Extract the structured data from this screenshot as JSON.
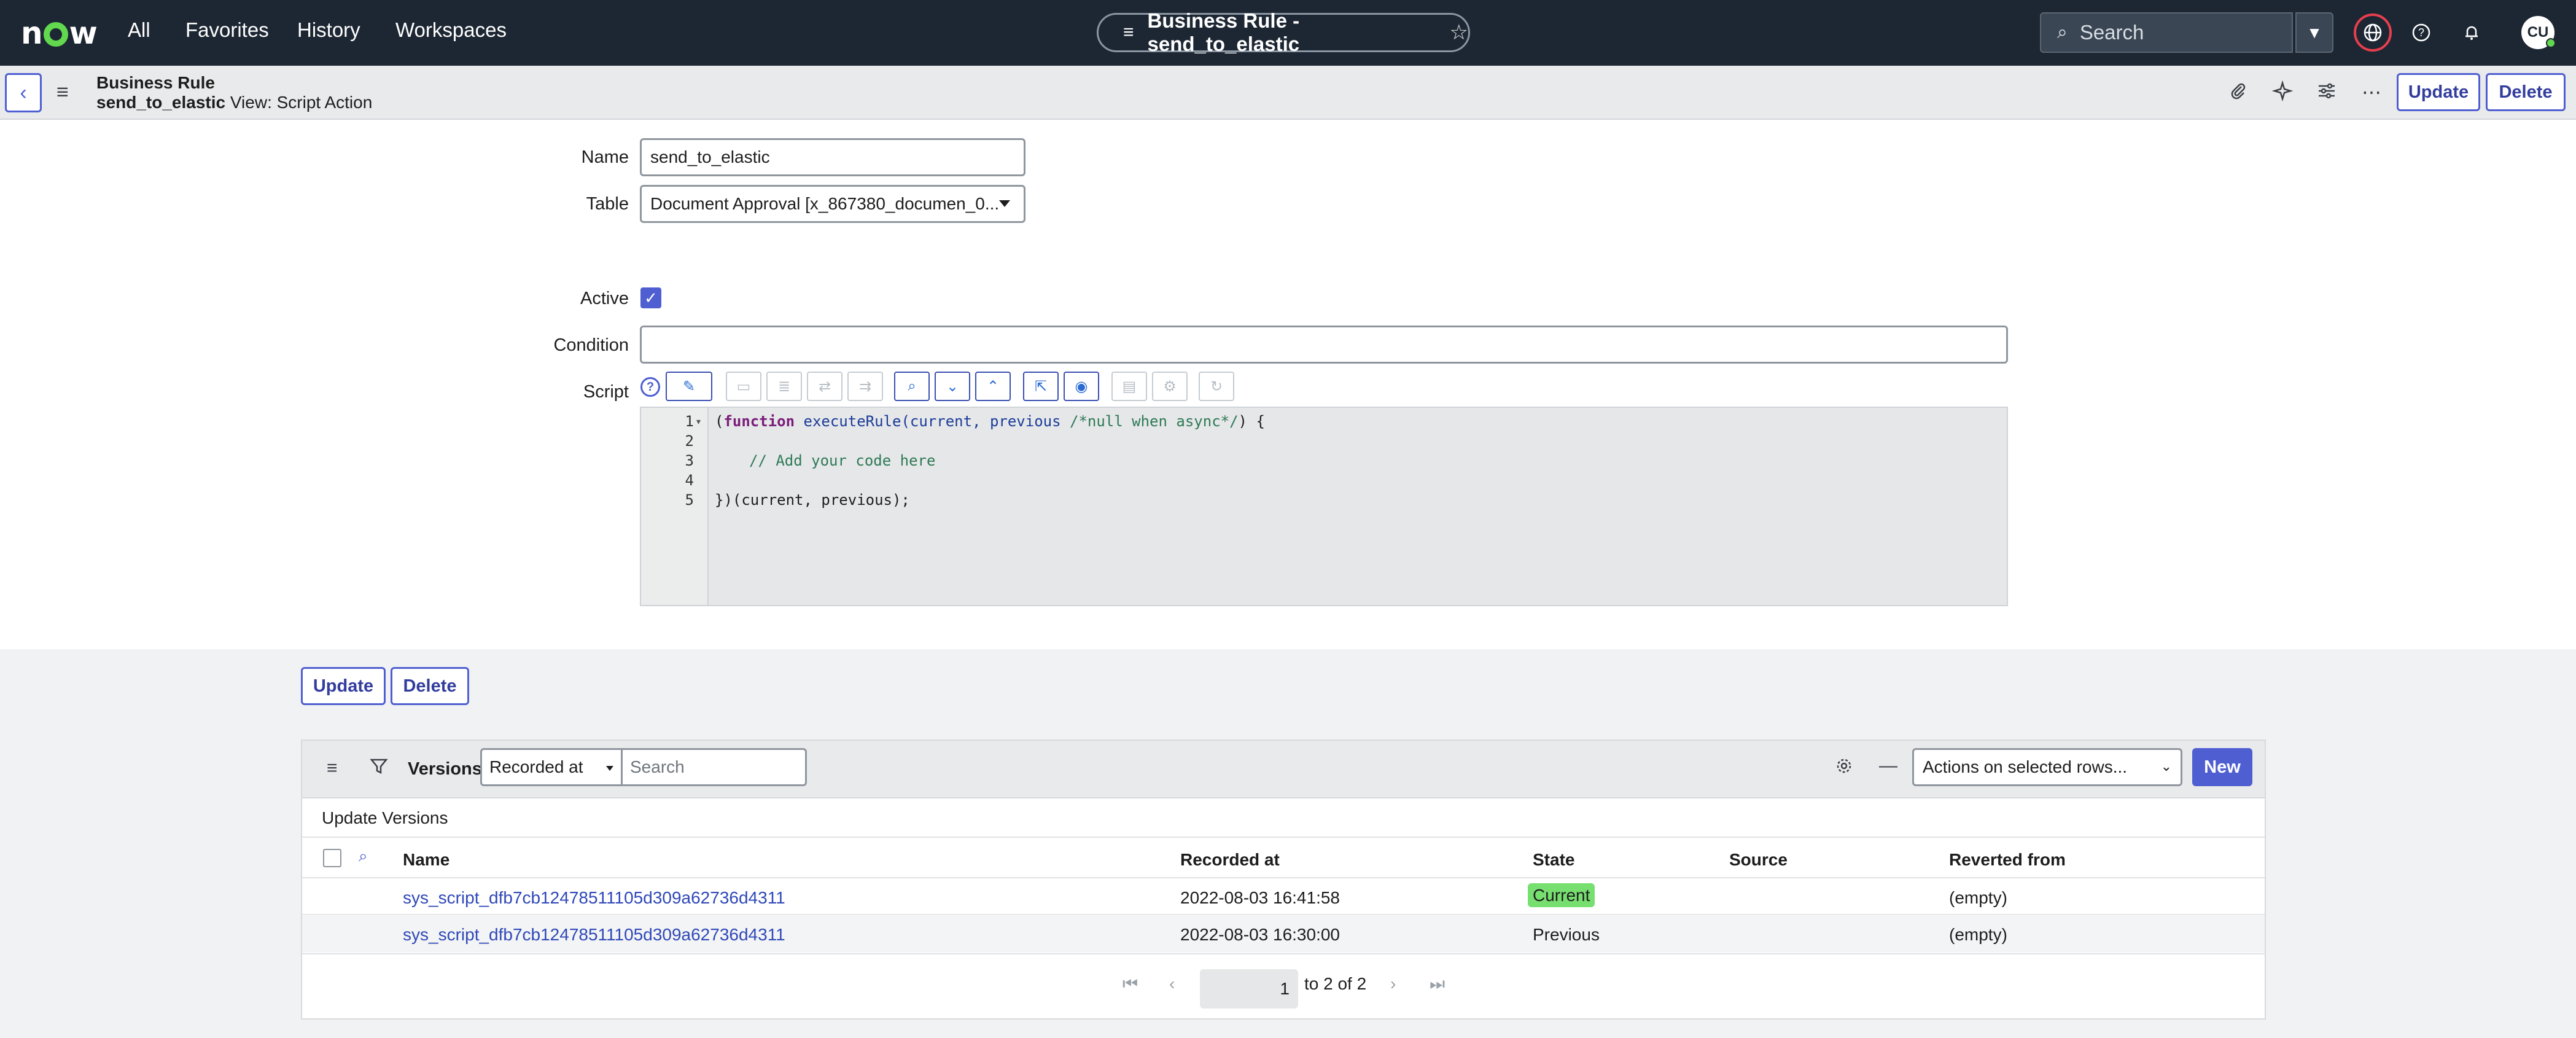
{
  "topnav": {
    "logo": "now",
    "items": [
      "All",
      "Favorites",
      "History",
      "Workspaces"
    ],
    "record_title": "Business Rule - send_to_elastic",
    "search_placeholder": "Search",
    "avatar_initials": "CU"
  },
  "form_header": {
    "title": "Business Rule",
    "record_name": "send_to_elastic",
    "view_label": "View: Script Action",
    "update_label": "Update",
    "delete_label": "Delete"
  },
  "form": {
    "name_label": "Name",
    "name_value": "send_to_elastic",
    "table_label": "Table",
    "table_value": "Document Approval [x_867380_documen_0...",
    "active_label": "Active",
    "active_checked": true,
    "condition_label": "Condition",
    "condition_value": "",
    "script_label": "Script",
    "line_numbers": [
      "1",
      "2",
      "3",
      "4",
      "5"
    ],
    "code": {
      "l1_open": "(",
      "l1_kw": "function",
      "l1_fn": "executeRule",
      "l1_mid": "(current, previous ",
      "l1_cm": "/*null when async*/",
      "l1_end": ") {",
      "l3_cm": "// Add your code here",
      "l5": "})(current, previous);"
    }
  },
  "footer_buttons": {
    "update_label": "Update",
    "delete_label": "Delete"
  },
  "related_list": {
    "title": "Versions",
    "filter_field": "Recorded at",
    "search_placeholder": "Search",
    "actions_label": "Actions on selected rows...",
    "new_label": "New",
    "subtitle": "Update Versions",
    "columns": [
      "Name",
      "Recorded at",
      "State",
      "Source",
      "Reverted from"
    ],
    "rows": [
      {
        "name": "sys_script_dfb7cb12478511105d309a62736d4311",
        "recorded_at": "2022-08-03 16:41:58",
        "state": "Current",
        "source": "",
        "reverted_from": "(empty)"
      },
      {
        "name": "sys_script_dfb7cb12478511105d309a62736d4311",
        "recorded_at": "2022-08-03 16:30:00",
        "state": "Previous",
        "source": "",
        "reverted_from": "(empty)"
      }
    ],
    "pagination": {
      "current_page": "1",
      "range_text": "to 2 of 2"
    }
  },
  "colors": {
    "nav_bg": "#1d2733",
    "accent": "#4f5fd1",
    "link": "#2f48b8",
    "current_badge": "#76df6f"
  }
}
